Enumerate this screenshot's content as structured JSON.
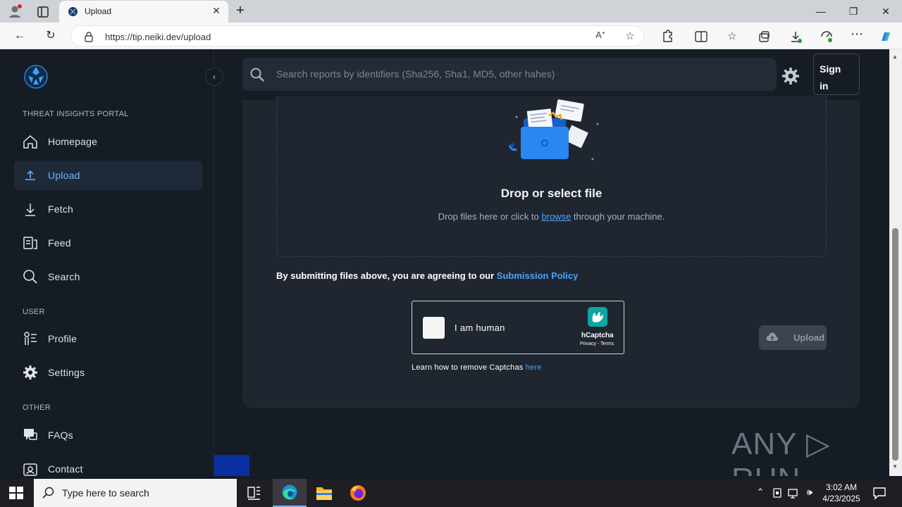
{
  "browser": {
    "tab_title": "Upload",
    "url": "https://tip.neiki.dev/upload",
    "new_tab": "+",
    "close_tab": "✕",
    "window_min": "—",
    "window_max": "❐",
    "window_close": "✕"
  },
  "sidebar": {
    "section_portal": "THREAT INSIGHTS PORTAL",
    "section_user": "USER",
    "section_other": "OTHER",
    "items": [
      {
        "label": "Homepage",
        "icon": "home-icon"
      },
      {
        "label": "Upload",
        "icon": "upload-icon",
        "active": true
      },
      {
        "label": "Fetch",
        "icon": "download-icon"
      },
      {
        "label": "Feed",
        "icon": "feed-icon"
      },
      {
        "label": "Search",
        "icon": "search-icon"
      },
      {
        "label": "Profile",
        "icon": "profile-icon"
      },
      {
        "label": "Settings",
        "icon": "gear-icon"
      },
      {
        "label": "FAQs",
        "icon": "faq-icon"
      },
      {
        "label": "Contact",
        "icon": "contact-icon"
      }
    ],
    "collapse": "‹"
  },
  "header": {
    "search_placeholder": "Search reports by identifiers (Sha256, Sha1, MD5, other hahes)",
    "signin_line1": "Sign",
    "signin_line2": "in"
  },
  "upload": {
    "drop_title": "Drop or select file",
    "drop_sub_before": "Drop files here or click to ",
    "drop_sub_link": "browse",
    "drop_sub_after": " through your machine.",
    "agree_text": "By submitting files above, you are agreeing to our ",
    "agree_link": "Submission Policy",
    "captcha_label": "I am human",
    "captcha_brand": "hCaptcha",
    "captcha_terms": "Privacy - Terms",
    "captcha_help_text": "Learn how to remove Captchas ",
    "captcha_help_link": "here",
    "upload_button": "Upload"
  },
  "watermark": "ANY ▷ RUN",
  "taskbar": {
    "search_placeholder": "Type here to search",
    "time": "3:02 AM",
    "date": "4/23/2025"
  },
  "colors": {
    "accent": "#4aa3ff",
    "background": "#161c24",
    "card": "#1f2630"
  }
}
